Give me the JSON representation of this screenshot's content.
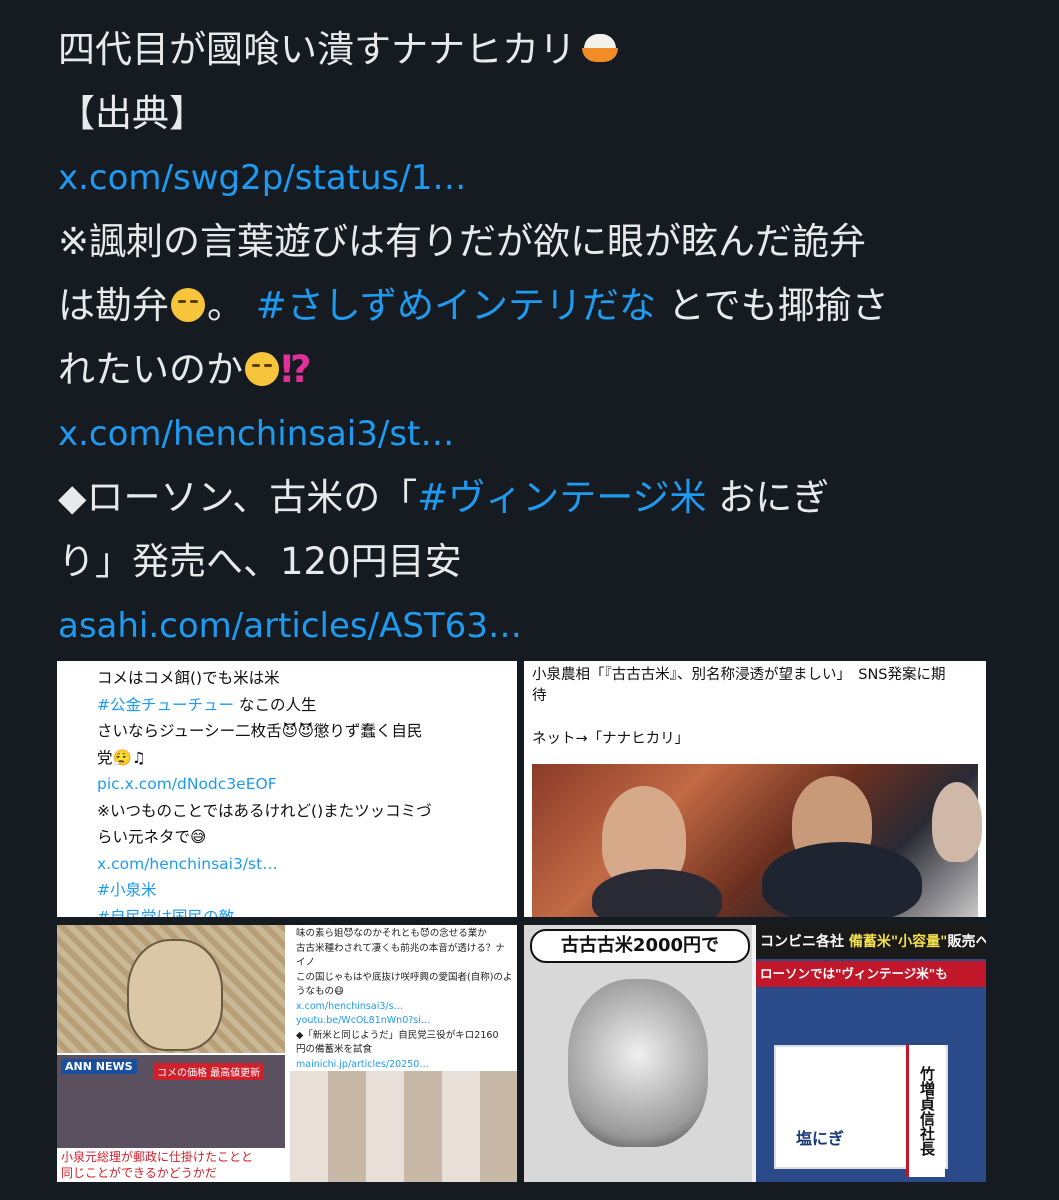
{
  "tweet": {
    "title": "四代目が國喰い潰すナナヒカリ",
    "source_label": "【出典】",
    "link1": "x.com/swg2p/status/1…",
    "para1_a": "※諷刺の言葉遊びは有りだが欲に眼が眩んだ詭弁",
    "para1_b": "は勘弁",
    "para1_c": "。",
    "hashtag1": "#さしずめインテリだな",
    "para1_d": " とでも揶揄さ",
    "para1_e": "れたいのか",
    "interrobang": "⁉",
    "link2": "x.com/henchinsai3/st…",
    "para2_a": "◆ローソン、古米の「",
    "hashtag2": "#ヴィンテージ米",
    "para2_b": " おにぎ",
    "para2_c": "り」発売へ、120円目安",
    "link3": "asahi.com/articles/AST63…"
  },
  "emoji": {
    "bowl": "rice-bowl-icon",
    "face1": "face-exhaling-icon",
    "face2": "thinking-face-icon"
  },
  "media": {
    "img1": {
      "lines": [
        "コメはコメ餌()でも米は米",
        "#公金チューチュー",
        "なこの人生",
        "さいならジューシー二枚舌😈😈懲りず蠢く自民",
        "党😮‍💨♫",
        "pic.x.com/dNodc3eEOF",
        "※いつものことではあるけれど()またツッコミづ",
        "らい元ネタで😅",
        "x.com/henchinsai3/st…",
        "#小泉米",
        "#自民党は国民の敵"
      ]
    },
    "img2": {
      "caption_line1": "小泉農相「『古古古米』、別名称浸透が望ましい」　SNS発案に期",
      "caption_line2": "待",
      "caption_line3": "ネット→「ナナヒカリ」"
    },
    "img3": {
      "ann": "ANN NEWS",
      "red_banner": "コメの価格 最高値更新",
      "news_line1": "小泉元総理が郵政に仕掛けたことと",
      "news_line2": "同じことができるかどうかだ",
      "mini_lines": [
        "味の素ら姐😈なのかそれとも😈の念せる業か",
        "古古米種わされて凄くも前兆の本音が透ける？ナ",
        "イノ",
        "この国じゃもはや底抜け咲呼興の愛国者(自称)のよ",
        "うなもの😷",
        "x.com/henchinsai3/s…",
        "youtu.be/WcOL81nWn0?si…",
        "◆「新米と同じようだ」自民党三役がキロ2160",
        "円の備蓄米を試食",
        "mainichi.jp/articles/20250…"
      ]
    },
    "img4": {
      "bubble": "古古古米2000円で",
      "tv_headline_a": "コンビニ各社 ",
      "tv_headline_b": "備蓄米\"小容量\"",
      "tv_headline_c": "販売へ",
      "tv_sub": "ローソンでは\"ヴィンテージ米\"も",
      "board_text": "塩にぎ",
      "name": "竹増貞信社長"
    }
  }
}
